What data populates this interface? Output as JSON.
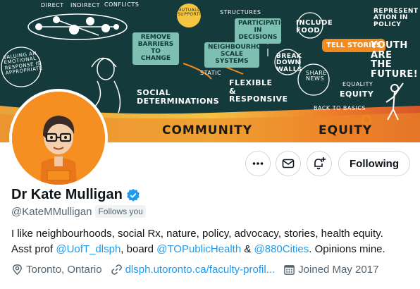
{
  "banner": {
    "doodles": [
      "DIRECT",
      "INDIRECT",
      "CONFLICTS",
      "MUTUALLY SUPPORTIVE",
      "STRUCTURES",
      "INCLUDE FOOD",
      "REPRESENT ATION IN POLICY",
      "REMOVE BARRIERS TO CHANGE",
      "PARTICIPATION IN DECISIONS",
      "TELL STORIES",
      "YOUTH ARE THE FUTURE!",
      "VALUING AN EMOTIONAL RESPONSE IS APPROPRIATE",
      "NEIGHBOURHOOD SCALE SYSTEMS",
      "BREAK DOWN WALLS",
      "SHARE NEWS",
      "STATIC",
      "FLEXIBLE & RESPONSIVE",
      "SOCIAL DETERMINATIONS",
      "EQUALITY",
      "EQUITY",
      "BACK TO BASICS",
      "COMMUNITY",
      "EQUITY"
    ]
  },
  "profile": {
    "name": "Dr Kate Mulligan",
    "handle": "@KateMMulligan",
    "follows_you": "Follows you",
    "bio_line1": "I like neighbourhoods, social Rx, nature, policy, advocacy, stories, health equity.",
    "bio_prefix": "Asst prof ",
    "bio_link1": "@UofT_dlsph",
    "bio_mid1": ", board ",
    "bio_link2": "@TOPublicHealth",
    "bio_mid2": " & ",
    "bio_link3": "@880Cities",
    "bio_suffix": ". Opinions mine.",
    "location": "Toronto, Ontario",
    "website": "dlsph.utoronto.ca/faculty-profil...",
    "joined": "Joined May 2017",
    "following_label": "Following"
  },
  "colors": {
    "accent": "#1d9bf0",
    "banner_bg": "#143a3c",
    "avatar_bg": "#f68f21"
  },
  "icons": [
    "more-icon",
    "mail-icon",
    "notification-plus-icon",
    "verified-icon",
    "location-icon",
    "link-icon",
    "calendar-icon"
  ]
}
